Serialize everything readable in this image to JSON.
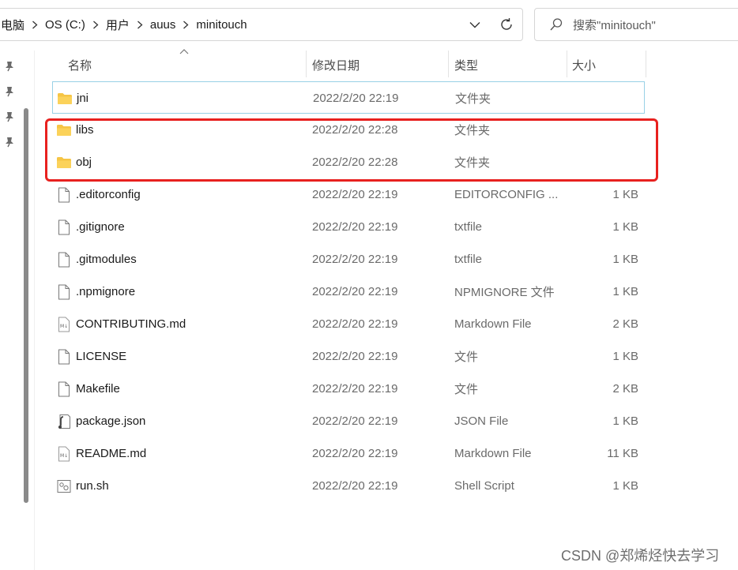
{
  "breadcrumbs": [
    "电脑",
    "OS (C:)",
    "用户",
    "auus",
    "minitouch"
  ],
  "search": {
    "placeholder": "搜索\"minitouch\""
  },
  "columns": {
    "name": "名称",
    "modified": "修改日期",
    "type": "类型",
    "size": "大小"
  },
  "files": [
    {
      "name": "jni",
      "modified": "2022/2/20 22:19",
      "type": "文件夹",
      "size": "",
      "icon": "folder"
    },
    {
      "name": "libs",
      "modified": "2022/2/20 22:28",
      "type": "文件夹",
      "size": "",
      "icon": "folder"
    },
    {
      "name": "obj",
      "modified": "2022/2/20 22:28",
      "type": "文件夹",
      "size": "",
      "icon": "folder"
    },
    {
      "name": ".editorconfig",
      "modified": "2022/2/20 22:19",
      "type": "EDITORCONFIG ...",
      "size": "1 KB",
      "icon": "file"
    },
    {
      "name": ".gitignore",
      "modified": "2022/2/20 22:19",
      "type": "txtfile",
      "size": "1 KB",
      "icon": "file"
    },
    {
      "name": ".gitmodules",
      "modified": "2022/2/20 22:19",
      "type": "txtfile",
      "size": "1 KB",
      "icon": "file"
    },
    {
      "name": ".npmignore",
      "modified": "2022/2/20 22:19",
      "type": "NPMIGNORE 文件",
      "size": "1 KB",
      "icon": "file"
    },
    {
      "name": "CONTRIBUTING.md",
      "modified": "2022/2/20 22:19",
      "type": "Markdown File",
      "size": "2 KB",
      "icon": "markdown"
    },
    {
      "name": "LICENSE",
      "modified": "2022/2/20 22:19",
      "type": "文件",
      "size": "1 KB",
      "icon": "file"
    },
    {
      "name": "Makefile",
      "modified": "2022/2/20 22:19",
      "type": "文件",
      "size": "2 KB",
      "icon": "file"
    },
    {
      "name": "package.json",
      "modified": "2022/2/20 22:19",
      "type": "JSON File",
      "size": "1 KB",
      "icon": "json"
    },
    {
      "name": "README.md",
      "modified": "2022/2/20 22:19",
      "type": "Markdown File",
      "size": "11 KB",
      "icon": "markdown"
    },
    {
      "name": "run.sh",
      "modified": "2022/2/20 22:19",
      "type": "Shell Script",
      "size": "1 KB",
      "icon": "shell"
    }
  ],
  "watermark": "CSDN @郑烯烃快去学习",
  "colors": {
    "highlight": "#e8211f",
    "selection_border": "#99d1e6",
    "folder": "#f6c545"
  }
}
